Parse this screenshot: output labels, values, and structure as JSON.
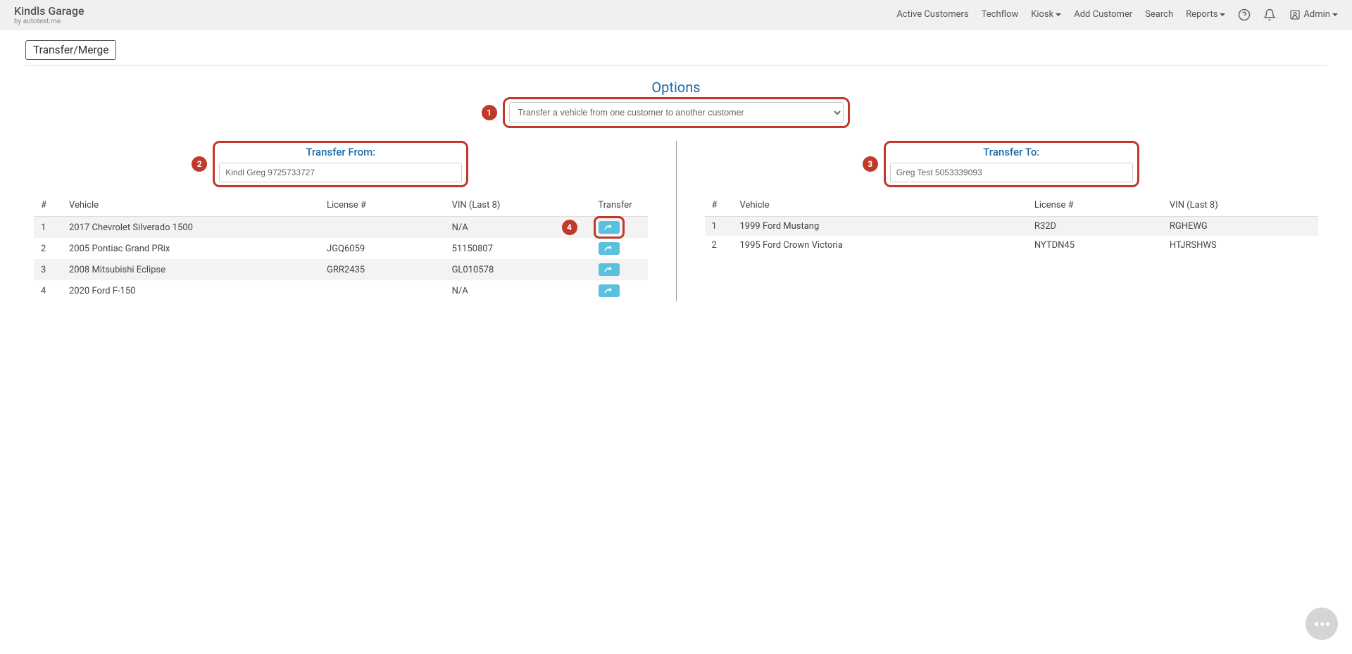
{
  "brand": {
    "title": "Kindls Garage",
    "subtitle": "by autotext.me"
  },
  "nav": {
    "active_customers": "Active Customers",
    "techflow": "Techflow",
    "kiosk": "Kiosk",
    "add_customer": "Add Customer",
    "search": "Search",
    "reports": "Reports",
    "admin": "Admin"
  },
  "page": {
    "tab": "Transfer/Merge",
    "options_label": "Options"
  },
  "options_select": {
    "value": "Transfer a vehicle from one customer to another customer"
  },
  "annotations": {
    "n1": "1",
    "n2": "2",
    "n3": "3",
    "n4": "4"
  },
  "from": {
    "label": "Transfer From:",
    "customer": "Kindl Greg 9725733727",
    "columns": {
      "idx": "#",
      "vehicle": "Vehicle",
      "license": "License #",
      "vin": "VIN (Last 8)",
      "transfer": "Transfer"
    },
    "rows": [
      {
        "idx": "1",
        "vehicle": "2017 Chevrolet Silverado 1500",
        "license": "",
        "vin": "N/A",
        "highlight": true
      },
      {
        "idx": "2",
        "vehicle": "2005 Pontiac Grand PRix",
        "license": "JGQ6059",
        "vin": "51150807"
      },
      {
        "idx": "3",
        "vehicle": "2008 Mitsubishi Eclipse",
        "license": "GRR2435",
        "vin": "GL010578"
      },
      {
        "idx": "4",
        "vehicle": "2020 Ford F-150",
        "license": "",
        "vin": "N/A"
      }
    ]
  },
  "to": {
    "label": "Transfer To:",
    "customer": "Greg Test 5053339093",
    "columns": {
      "idx": "#",
      "vehicle": "Vehicle",
      "license": "License #",
      "vin": "VIN (Last 8)"
    },
    "rows": [
      {
        "idx": "1",
        "vehicle": "1999 Ford Mustang",
        "license": "R32D",
        "vin": "RGHEWG"
      },
      {
        "idx": "2",
        "vehicle": "1995 Ford Crown Victoria",
        "license": "NYTDN45",
        "vin": "HTJRSHWS"
      }
    ]
  }
}
